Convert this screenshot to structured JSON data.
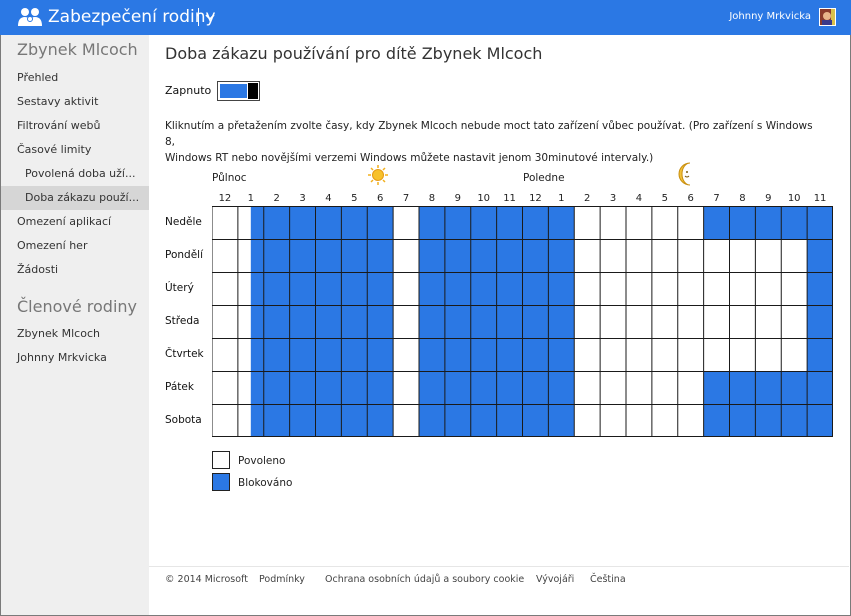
{
  "app": {
    "title": "Zabezpečení rodiny",
    "user": "Johnny Mrkvicka"
  },
  "sidebar": {
    "child_name": "Zbynek Mlcoch",
    "items": [
      {
        "label": "Přehled"
      },
      {
        "label": "Sestavy aktivit"
      },
      {
        "label": "Filtrování webů"
      },
      {
        "label": "Časové limity"
      },
      {
        "label": "Povolená doba uží..."
      },
      {
        "label": "Doba zákazu použí..."
      },
      {
        "label": "Omezení aplikací"
      },
      {
        "label": "Omezení her"
      },
      {
        "label": "Žádosti"
      }
    ],
    "family_heading": "Členové rodiny",
    "family": [
      {
        "label": "Zbynek Mlcoch"
      },
      {
        "label": "Johnny Mrkvicka"
      }
    ]
  },
  "main": {
    "title": "Doba zákazu používání pro dítě Zbynek Mlcoch",
    "toggle_label": "Zapnuto",
    "toggle_on": true,
    "description_line1": "Kliknutím a přetažením zvolte časy, kdy Zbynek Mlcoch nebude moct tato zařízení vůbec používat. (Pro zařízení s Windows 8,",
    "description_line2": "Windows RT nebo novějšími verzemi Windows můžete nastavit jenom 30minutové intervaly.)",
    "midnight_label": "Půlnoc",
    "noon_label": "Poledne",
    "hours": [
      "12",
      "1",
      "2",
      "3",
      "4",
      "5",
      "6",
      "7",
      "8",
      "9",
      "10",
      "11",
      "12",
      "1",
      "2",
      "3",
      "4",
      "5",
      "6",
      "7",
      "8",
      "9",
      "10",
      "11"
    ],
    "days": [
      "Neděle",
      "Pondělí",
      "Úterý",
      "Středa",
      "Čtvrtek",
      "Pátek",
      "Sobota"
    ],
    "blocked_halfhours": [
      [
        [
          3,
          14
        ],
        [
          16,
          28
        ],
        [
          38,
          48
        ]
      ],
      [
        [
          3,
          14
        ],
        [
          16,
          28
        ],
        [
          46,
          48
        ]
      ],
      [
        [
          3,
          14
        ],
        [
          16,
          28
        ],
        [
          46,
          48
        ]
      ],
      [
        [
          3,
          14
        ],
        [
          16,
          28
        ],
        [
          46,
          48
        ]
      ],
      [
        [
          3,
          14
        ],
        [
          16,
          28
        ],
        [
          46,
          48
        ]
      ],
      [
        [
          3,
          14
        ],
        [
          16,
          28
        ],
        [
          38,
          48
        ]
      ],
      [
        [
          3,
          14
        ],
        [
          16,
          28
        ],
        [
          38,
          48
        ]
      ]
    ],
    "legend_allowed": "Povoleno",
    "legend_blocked": "Blokováno",
    "colors": {
      "blocked": "#2b78e4",
      "allowed": "#ffffff",
      "accent": "#2b78e4"
    }
  },
  "footer": {
    "copyright": "© 2014 Microsoft",
    "links": [
      {
        "label": "Podmínky"
      },
      {
        "label": "Ochrana osobních údajů a soubory cookie"
      },
      {
        "label": "Vývojáři"
      },
      {
        "label": "Čeština"
      }
    ]
  }
}
